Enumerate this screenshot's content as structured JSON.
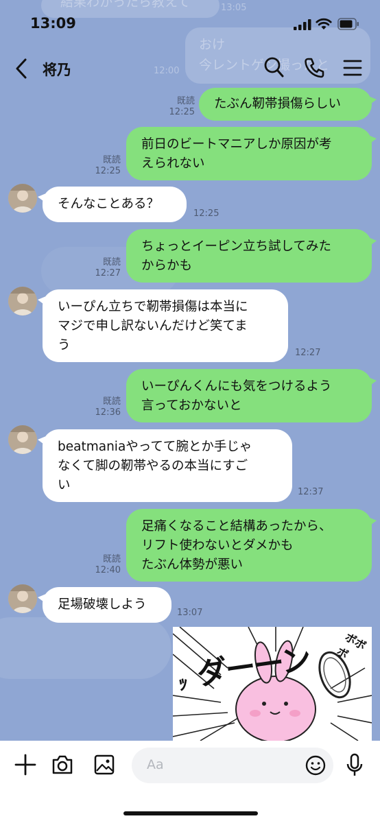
{
  "status": {
    "time": "13:09"
  },
  "notification_ghost": {
    "line1": "結果わかったら教えて",
    "line2": "おけ",
    "line3": "今レントゲン撮ったと",
    "time1": "13:05",
    "time2": "12:00"
  },
  "header": {
    "contact_name": "将乃"
  },
  "messages": [
    {
      "side": "right",
      "text": "たぶん靭帯損傷らしい",
      "read": "既読",
      "time": "12:25"
    },
    {
      "side": "right",
      "lines": [
        "前日のビートマニアしか原因が考",
        "えられない"
      ],
      "read": "既読",
      "time": "12:25"
    },
    {
      "side": "left",
      "text": "そんなことある？",
      "time": "12:25"
    },
    {
      "side": "right",
      "lines": [
        "ちょっとイーピン立ち試してみた",
        "からかも"
      ],
      "read": "既読",
      "time": "12:27"
    },
    {
      "side": "left",
      "lines": [
        "いーぴん立ちで靭帯損傷は本当に",
        "マジで申し訳ないんだけど笑てま",
        "う"
      ],
      "time": "12:27"
    },
    {
      "side": "right",
      "lines": [
        "いーぴんくんにも気をつけるよう",
        "言っておかないと"
      ],
      "read": "既読",
      "time": "12:36"
    },
    {
      "side": "left",
      "lines": [
        "beatmaniaやってて腕とか手じゃ",
        "なくて脚の靭帯やるの本当にすご",
        "い"
      ],
      "time": "12:37"
    },
    {
      "side": "right",
      "lines": [
        "足痛くなること結構あったから、",
        "リフト使わないとダメかも",
        "たぶん体勢が悪い"
      ],
      "read": "既読",
      "time": "12:40"
    },
    {
      "side": "left",
      "text": "足場破壊しよう",
      "time": "13:07"
    }
  ],
  "sticker": {
    "text": "ダーーン",
    "sfx": "ｯ",
    "side_text": "ボボボ"
  },
  "input": {
    "placeholder": "Aa"
  },
  "icons": [
    "back-chevron-icon",
    "search-icon",
    "phone-icon",
    "menu-icon",
    "plus-icon",
    "camera-icon",
    "image-icon",
    "emoji-icon",
    "microphone-icon"
  ]
}
